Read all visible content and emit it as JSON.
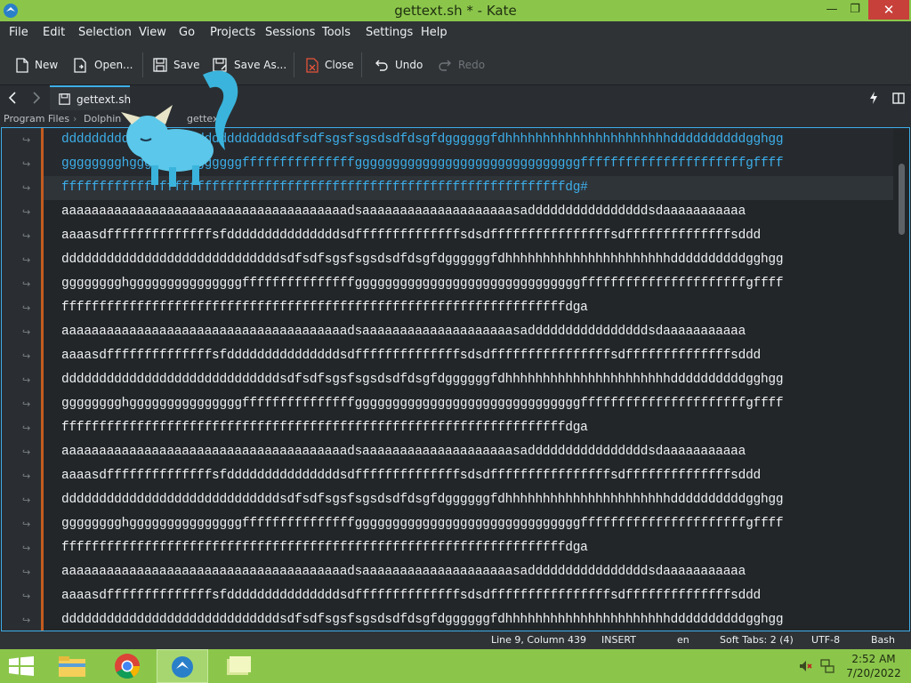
{
  "window": {
    "title": "gettext.sh * - Kate"
  },
  "menu": [
    "File",
    "Edit",
    "Selection",
    "View",
    "Go",
    "Projects",
    "Sessions",
    "Tools",
    "Settings",
    "Help"
  ],
  "toolbar": {
    "new_label": "New",
    "open_label": "Open...",
    "save_label": "Save",
    "save_as_label": "Save As...",
    "close_label": "Close",
    "undo_label": "Undo",
    "redo_label": "Redo"
  },
  "tab": {
    "label": "gettext.sh"
  },
  "breadcrumb": {
    "part1": "Program Files",
    "part2": "Dolphin",
    "part3": "gettext."
  },
  "editor": {
    "lines": [
      "dddddddddddddddddddddddddddddsdfsdfsgsfsgsdsdfdsgfdggggggfdhhhhhhhhhhhhhhhhhhhhhhddddddddddgghgg",
      "gggggggghgggggggggggggggfffffffffffffffggggggggggggggggggggggggggggggffffffffffffffffffffffgffff",
      "fffffffffffffffffffffffffffffffffffffffffffffffffffffffffffffffffffdg#",
      "aaaaaaaaaaaaaaaaaaaaaaaaaaaaaaaaaaaaaadsaaaaaaaaaaaaaaaaaaaasaddddddddddddddddsdaaaaaaaaaaa",
      "aaaasdffffffffffffffsfdddddddddddddddsdffffffffffffffsdsdffffffffffffffffsdffffffffffffffsddd",
      "dddddddddddddddddddddddddddddsdfsdfsgsfsgsdsdfdsgfdggggggfdhhhhhhhhhhhhhhhhhhhhhhddddddddddgghgg",
      "gggggggghgggggggggggggggfffffffffffffffggggggggggggggggggggggggggggggffffffffffffffffffffffgffff",
      "fffffffffffffffffffffffffffffffffffffffffffffffffffffffffffffffffffdga",
      "aaaaaaaaaaaaaaaaaaaaaaaaaaaaaaaaaaaaaadsaaaaaaaaaaaaaaaaaaaasaddddddddddddddddsdaaaaaaaaaaa",
      "aaaasdffffffffffffffsfdddddddddddddddsdffffffffffffffsdsdffffffffffffffffsdffffffffffffffsddd",
      "dddddddddddddddddddddddddddddsdfsdfsgsfsgsdsdfdsgfdggggggfdhhhhhhhhhhhhhhhhhhhhhhddddddddddgghgg",
      "gggggggghgggggggggggggggfffffffffffffffggggggggggggggggggggggggggggggffffffffffffffffffffffgffff",
      "fffffffffffffffffffffffffffffffffffffffffffffffffffffffffffffffffffdga",
      "aaaaaaaaaaaaaaaaaaaaaaaaaaaaaaaaaaaaaadsaaaaaaaaaaaaaaaaaaaasaddddddddddddddddsdaaaaaaaaaaa",
      "aaaasdffffffffffffffsfdddddddddddddddsdffffffffffffffsdsdffffffffffffffffsdffffffffffffffsddd",
      "dddddddddddddddddddddddddddddsdfsdfsgsfsgsdsdfdsgfdggggggfdhhhhhhhhhhhhhhhhhhhhhhddddddddddgghgg",
      "gggggggghgggggggggggggggfffffffffffffffggggggggggggggggggggggggggggggffffffffffffffffffffffgffff",
      "fffffffffffffffffffffffffffffffffffffffffffffffffffffffffffffffffffdga",
      "aaaaaaaaaaaaaaaaaaaaaaaaaaaaaaaaaaaaaadsaaaaaaaaaaaaaaaaaaaasaddddddddddddddddsdaaaaaaaaaaa",
      "aaaasdffffffffffffffsfdddddddddddddddsdffffffffffffffsdsdffffffffffffffffsdffffffffffffffsddd",
      "dddddddddddddddddddddddddddddsdfsdfsgsfsgsdsdfdsgfdggggggfdhhhhhhhhhhhhhhhhhhhhhhddddddddddgghgg"
    ],
    "selected_lines": 3
  },
  "status": {
    "position": "Line 9, Column 439",
    "mode": "INSERT",
    "language": "en",
    "indent": "Soft Tabs: 2 (4)",
    "encoding": "UTF-8",
    "syntax": "Bash"
  },
  "taskbar": {
    "time": "2:52 AM",
    "date": "7/20/2022"
  },
  "colors": {
    "accent": "#3daee9",
    "titlebar": "#8bc64b",
    "marker": "#c35b1f",
    "close": "#c7403a"
  }
}
